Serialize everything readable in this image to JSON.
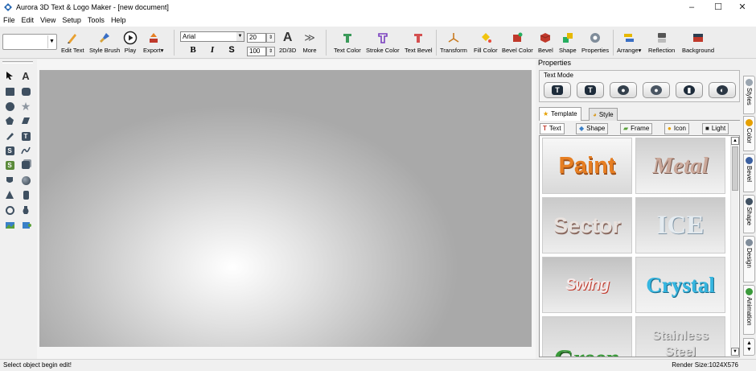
{
  "window": {
    "title": "Aurora 3D Text & Logo Maker - [new document]",
    "controls": {
      "minimize": "–",
      "maximize": "☐",
      "close": "✕"
    }
  },
  "menu": [
    "File",
    "Edit",
    "View",
    "Setup",
    "Tools",
    "Help"
  ],
  "toolbar": {
    "edit_text": "Edit Text",
    "style_brush": "Style Brush",
    "play": "Play",
    "export": "Export▾",
    "font_name": "Arial",
    "font_size": "20",
    "depth_value": "100",
    "bold": "B",
    "italic": "I",
    "strike": "S",
    "mode_2d3d": "2D/3D",
    "more": "More",
    "text_color": "Text Color",
    "stroke_color": "Stroke Color",
    "text_bevel": "Text Bevel",
    "transform": "Transform",
    "fill_color": "Fill Color",
    "bevel_color": "Bevel Color",
    "bevel": "Bevel",
    "shape": "Shape",
    "properties": "Properties",
    "arrange": "Arrange▾",
    "reflection": "Reflection",
    "background": "Background"
  },
  "properties": {
    "title": "Properties",
    "text_mode": "Text Mode",
    "tabs": {
      "template": "Template",
      "style": "Style"
    },
    "subtabs": {
      "text": "Text",
      "shape": "Shape",
      "frame": "Frame",
      "icon": "Icon",
      "light": "Light"
    },
    "templates": [
      "Paint",
      "Metal",
      "Sector",
      "ICE",
      "Swing",
      "Crystal",
      "Green",
      "Stainless Steel"
    ]
  },
  "side_tabs": [
    "Styles",
    "Color",
    "Bevel",
    "Shape",
    "Design",
    "Animation"
  ],
  "status": {
    "message": "Select object begin edit!",
    "render_size": "Render Size:1024X576"
  },
  "colors": {
    "accent_red": "#c0392b",
    "accent_orange": "#e67e22",
    "crystal_blue": "#36b6e0",
    "green_text": "#3a9a3a"
  }
}
